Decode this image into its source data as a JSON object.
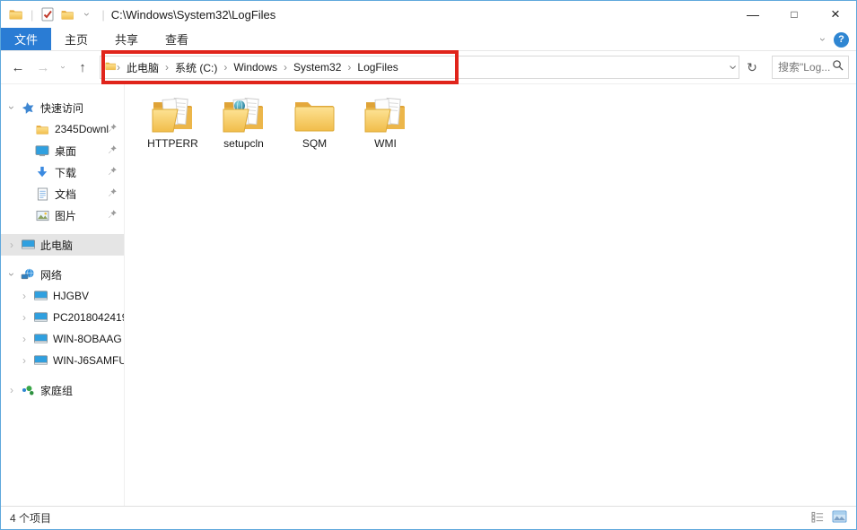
{
  "titlebar": {
    "title": "C:\\Windows\\System32\\LogFiles"
  },
  "icons": {
    "minimize": "—",
    "maximize": "□",
    "close": "×",
    "back": "←",
    "forward": "→",
    "up": "↑",
    "refresh": "↻",
    "chevron": "›"
  },
  "ribbon": {
    "tabs": [
      {
        "label": "文件",
        "active": true
      },
      {
        "label": "主页",
        "active": false
      },
      {
        "label": "共享",
        "active": false
      },
      {
        "label": "查看",
        "active": false
      }
    ],
    "help_glyph": "?"
  },
  "address": {
    "breadcrumb": [
      "此电脑",
      "系统 (C:)",
      "Windows",
      "System32",
      "LogFiles"
    ]
  },
  "search": {
    "placeholder": "搜索\"Log..."
  },
  "sidebar": {
    "quick_access": {
      "label": "快速访问"
    },
    "quick_items": [
      {
        "label": "2345Downl",
        "icon": "folder"
      },
      {
        "label": "桌面",
        "icon": "desktop-monitor"
      },
      {
        "label": "下载",
        "icon": "download-arrow"
      },
      {
        "label": "文档",
        "icon": "document"
      },
      {
        "label": "图片",
        "icon": "picture"
      }
    ],
    "this_pc": {
      "label": "此电脑"
    },
    "network": {
      "label": "网络"
    },
    "network_items": [
      {
        "label": "HJGBV"
      },
      {
        "label": "PC2018042419"
      },
      {
        "label": "WIN-8OBAAG"
      },
      {
        "label": "WIN-J6SAMFU"
      }
    ],
    "homegroup": {
      "label": "家庭组"
    }
  },
  "files": [
    {
      "name": "HTTPERR",
      "icon": "folder-with-documents"
    },
    {
      "name": "setupcln",
      "icon": "folder-with-log-documents"
    },
    {
      "name": "SQM",
      "icon": "folder-empty"
    },
    {
      "name": "WMI",
      "icon": "folder-with-documents"
    }
  ],
  "statusbar": {
    "items_count": "4 个项目"
  },
  "annotation": {
    "type": "red-highlight-box-around-breadcrumb"
  },
  "colors": {
    "accent_blue": "#2a7cd4",
    "annotation_red": "#e0241b",
    "folder_yellow": "#f6cd57",
    "selection_gray": "#e5e5e5",
    "window_border_blue": "#5fa8dc"
  }
}
